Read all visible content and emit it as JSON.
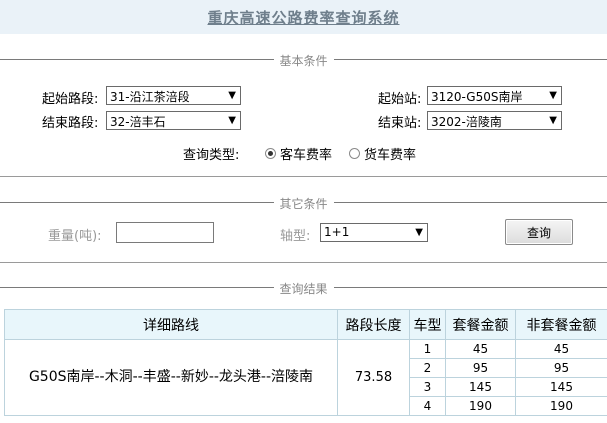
{
  "title": "重庆高速公路费率查询系统",
  "sections": {
    "basic": "基本条件",
    "other": "其它条件",
    "results": "查询结果"
  },
  "form": {
    "start_section_label": "起始路段:",
    "start_section_value": "31-沿江茶涪段",
    "end_section_label": "结束路段:",
    "end_section_value": "32-涪丰石",
    "start_station_label": "起始站:",
    "start_station_value": "3120-G50S南岸",
    "end_station_label": "结束站:",
    "end_station_value": "3202-涪陵南",
    "query_type_label": "查询类型:",
    "query_type_options": [
      "客车费率",
      "货车费率"
    ],
    "query_type_selected": "客车费率",
    "weight_label": "重量(吨):",
    "weight_value": "",
    "axle_label": "轴型:",
    "axle_value": "1+1",
    "query_button": "查询"
  },
  "table": {
    "headers": [
      "详细路线",
      "路段长度",
      "车型",
      "套餐金额",
      "非套餐金额"
    ],
    "route": "G50S南岸--木洞--丰盛--新妙--龙头港--涪陵南",
    "length": "73.58",
    "rows": [
      {
        "type": "1",
        "package": "45",
        "non_package": "45"
      },
      {
        "type": "2",
        "package": "95",
        "non_package": "95"
      },
      {
        "type": "3",
        "package": "145",
        "non_package": "145"
      },
      {
        "type": "4",
        "package": "190",
        "non_package": "190"
      }
    ]
  },
  "icons": {
    "dropdown": "chevron-down-icon"
  }
}
